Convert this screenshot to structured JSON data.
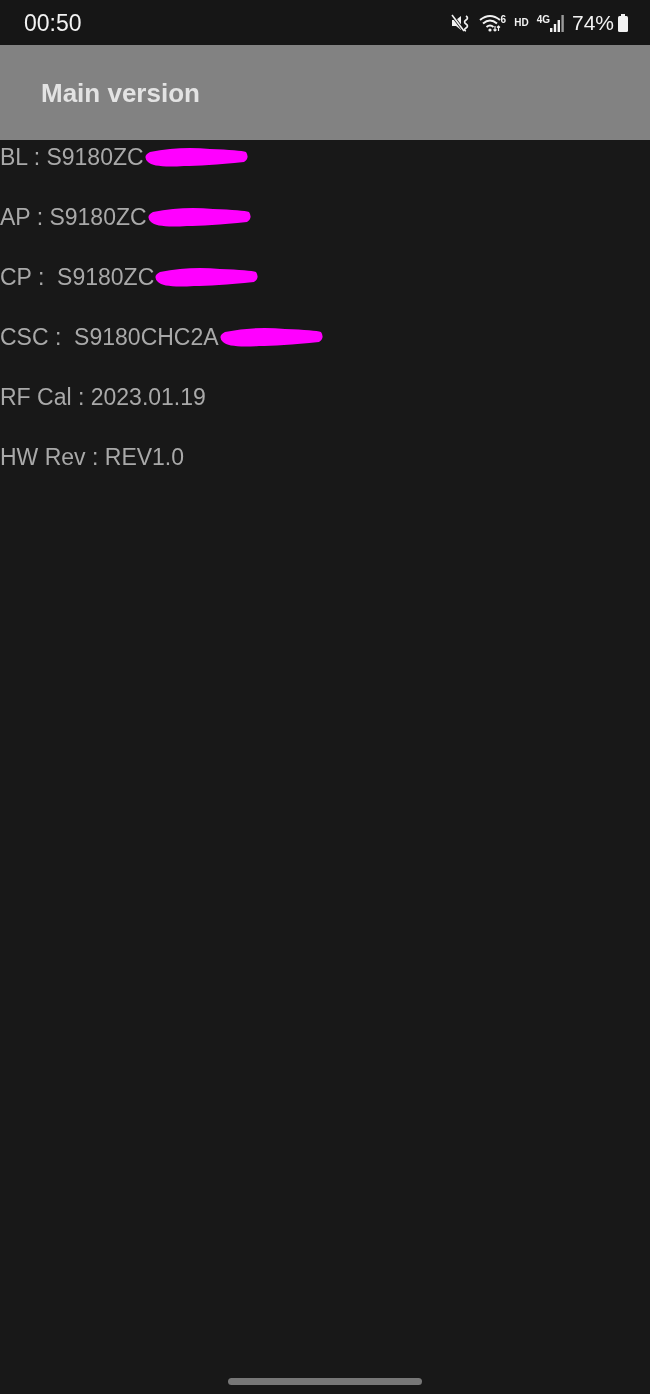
{
  "status_bar": {
    "time": "00:50",
    "wifi_generation": "6",
    "hd_label": "HD",
    "network_type": "4G",
    "battery": "74%"
  },
  "app_bar": {
    "title": "Main version"
  },
  "rows": [
    {
      "text": "BL : S9180ZC",
      "redacted": true
    },
    {
      "text": "AP : S9180ZC",
      "redacted": true
    },
    {
      "text": "CP :  S9180ZC",
      "redacted": true
    },
    {
      "text": "CSC :  S9180CHC2A",
      "redacted": true
    },
    {
      "text": "RF Cal : 2023.01.19",
      "redacted": false
    },
    {
      "text": "HW Rev : REV1.0",
      "redacted": false
    }
  ]
}
